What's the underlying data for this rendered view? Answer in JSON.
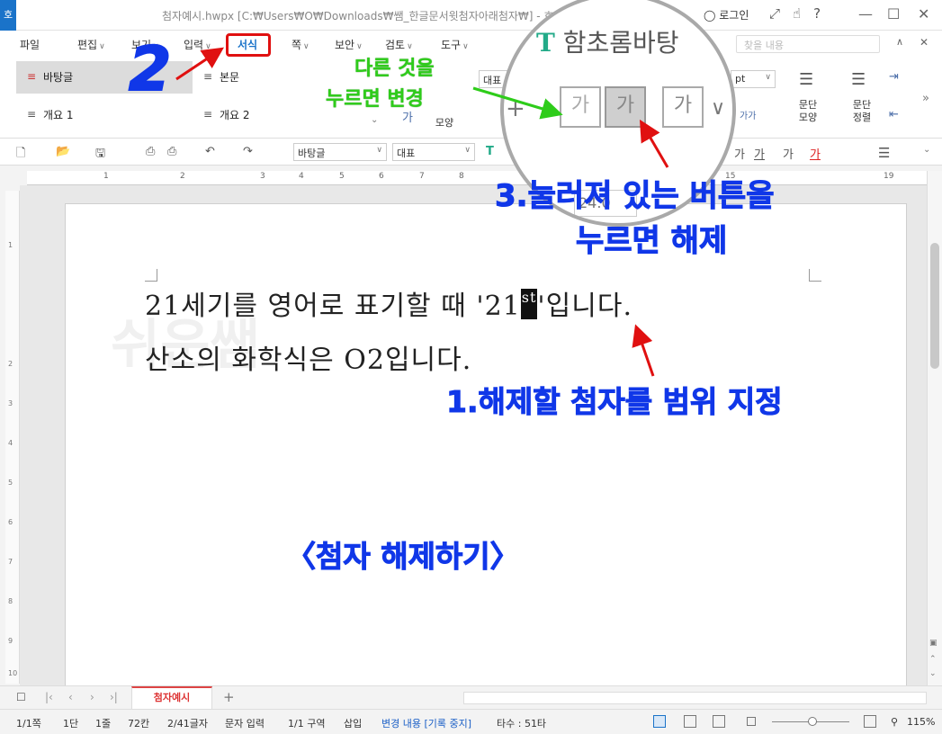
{
  "window": {
    "app_icon": "호",
    "title": "첨자예시.hwpx [C:₩Users₩O₩Downloads₩쌤_한글문서윗첨자아래첨자₩] - 호",
    "login": "로그인",
    "login_icon": "user-circle-icon"
  },
  "menu": {
    "items": [
      {
        "label": "파일",
        "caret": false
      },
      {
        "label": "편집",
        "caret": true
      },
      {
        "label": "보기",
        "caret": true
      },
      {
        "label": "입력",
        "caret": true
      },
      {
        "label": "서식",
        "caret": false,
        "active": true
      },
      {
        "label": "쪽",
        "caret": true
      },
      {
        "label": "보안",
        "caret": true
      },
      {
        "label": "검토",
        "caret": true
      },
      {
        "label": "도구",
        "caret": true
      }
    ],
    "find_placeholder": "찾을 내용"
  },
  "ribbon": {
    "styles": [
      "바탕글",
      "본문",
      "개요 1",
      "개요 2"
    ],
    "font_partial": "대표",
    "pt_unit": "pt",
    "shape_label": "모양",
    "paragraph_shape": "문단\n모양",
    "paragraph_align": "문단\n정렬"
  },
  "format_toolbar": {
    "style_select": "바탕글",
    "lang_select": "대표",
    "char_buttons": [
      "가",
      "가",
      "가",
      "가",
      "가"
    ]
  },
  "ruler": {
    "numbers": [
      "1",
      "2",
      "3",
      "4",
      "5",
      "6",
      "7",
      "8",
      "15",
      "19"
    ]
  },
  "vertical_ruler": {
    "numbers": [
      "1",
      "2",
      "3",
      "4",
      "5",
      "6",
      "7",
      "8",
      "9",
      "10"
    ]
  },
  "document": {
    "watermark": "쉬운쌤",
    "line1_before": "21세기를 영어로 표기할 때 '21",
    "line1_sup": "st",
    "line1_after": "'입니다.",
    "line2": "산소의 화학식은 O2입니다."
  },
  "magnifier": {
    "font_name": "함초롬바탕",
    "font_icon": "T",
    "size_partial": "24.0",
    "btn_sub": "가",
    "btn_sup": "가",
    "btn_box": "가"
  },
  "annotations": {
    "step2": "2",
    "change_hint_line1": "다른 것을",
    "change_hint_line2": "누르면 변경",
    "step3_line1": "3.눌러져 있는 버튼을",
    "step3_line2": "누르면 해제",
    "step1": "1.해제할 첨자를 범위 지정",
    "caption": "〈첨자 해제하기〉"
  },
  "tabs": {
    "doc_tab": "첨자예시",
    "add": "+"
  },
  "status": {
    "page": "1/1쪽",
    "column": "1단",
    "line": "1줄",
    "col_pos": "72칸",
    "chars": "2/41글자",
    "mode": "문자 입력",
    "section": "1/1 구역",
    "insert": "삽입",
    "track": "변경 내용 [기록 중지]",
    "typing": "타수 : 51타",
    "zoom": "115%"
  },
  "colors": {
    "annotation_blue": "#1037e8",
    "annotation_green": "#2ecc1a",
    "annotation_red": "#e01010",
    "accent": "#1a73c9"
  }
}
